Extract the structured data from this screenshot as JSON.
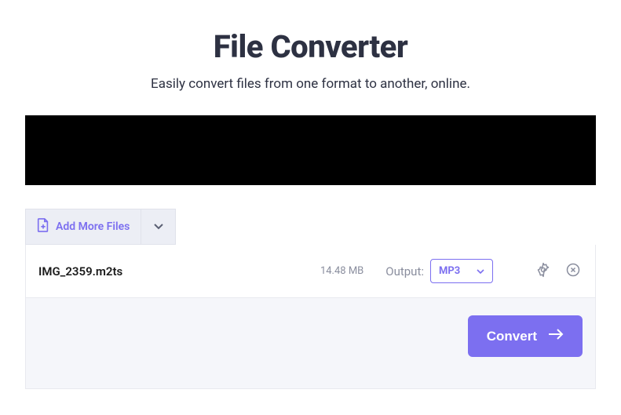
{
  "header": {
    "title": "File Converter",
    "subtitle": "Easily convert files from one format to another, online."
  },
  "toolbar": {
    "add_more_label": "Add More Files"
  },
  "file": {
    "name": "IMG_2359.m2ts",
    "size": "14.48 MB",
    "output_label": "Output:",
    "format": "MP3"
  },
  "actions": {
    "convert_label": "Convert"
  },
  "colors": {
    "accent": "#7c6ff0",
    "text_dark": "#2d3142",
    "text_muted": "#8a8e9e",
    "toolbar_bg": "#eceef5",
    "footer_bg": "#f5f6fa"
  }
}
